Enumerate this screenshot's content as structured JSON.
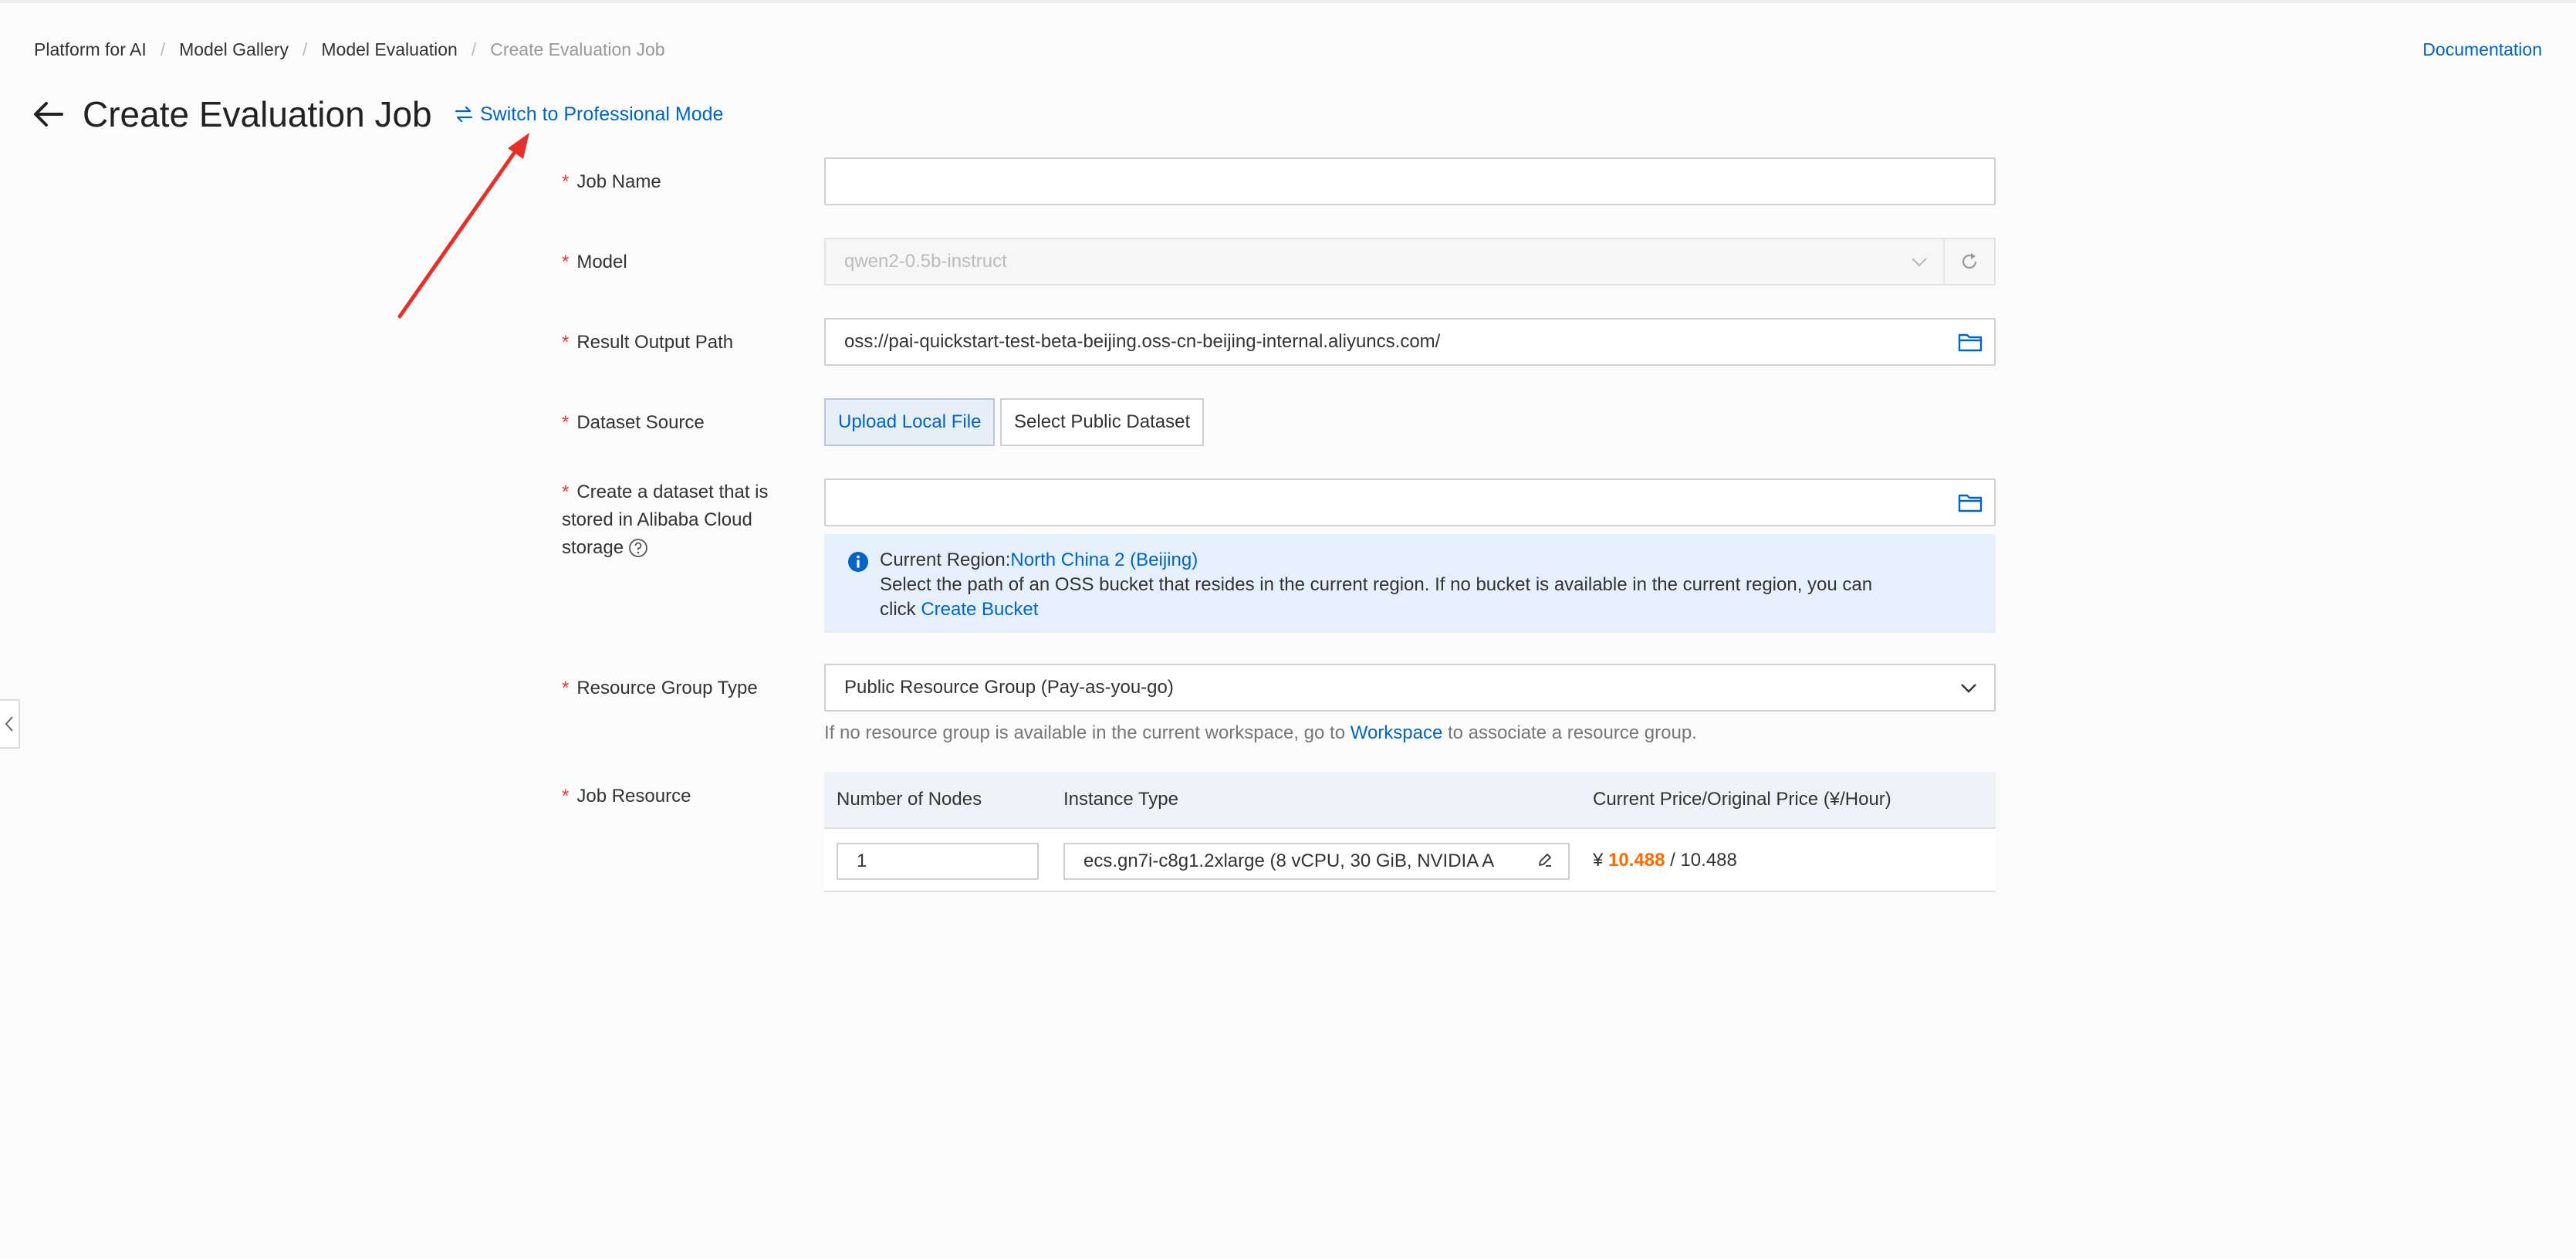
{
  "breadcrumb": {
    "items": [
      "Platform for AI",
      "Model Gallery",
      "Model Evaluation"
    ],
    "current": "Create Evaluation Job",
    "separator": "/"
  },
  "header": {
    "documentation_link": "Documentation",
    "title": "Create Evaluation Job",
    "switch_mode_label": "Switch to Professional Mode"
  },
  "form": {
    "required_marker": "*",
    "job_name": {
      "label": "Job Name",
      "value": ""
    },
    "model": {
      "label": "Model",
      "value": "qwen2-0.5b-instruct"
    },
    "result_output_path": {
      "label": "Result Output Path",
      "value": "oss://pai-quickstart-test-beta-beijing.oss-cn-beijing-internal.aliyuncs.com/"
    },
    "dataset_source": {
      "label": "Dataset Source",
      "options": [
        "Upload Local File",
        "Select Public Dataset"
      ],
      "selected": "Upload Local File"
    },
    "dataset_storage": {
      "label_line1": "Create a dataset that is",
      "label_line2": "stored in Alibaba Cloud",
      "label_line3": "storage",
      "value": "",
      "info": {
        "region_prefix": "Current Region:",
        "region": "North China 2 (Beijing)",
        "message": "Select the path of an OSS bucket that resides in the current region. If no bucket is available in the current region, you can",
        "click_text": "click",
        "create_bucket_link": "Create Bucket"
      }
    },
    "resource_group_type": {
      "label": "Resource Group Type",
      "value": "Public Resource Group (Pay-as-you-go)",
      "help_prefix": "If no resource group is available in the current workspace, go to",
      "help_link": "Workspace",
      "help_suffix": "to associate a resource group."
    },
    "job_resource": {
      "label": "Job Resource",
      "columns": [
        "Number of Nodes",
        "Instance Type",
        "Current Price/Original Price (¥/Hour)"
      ],
      "nodes": "1",
      "instance_type": "ecs.gn7i-c8g1.2xlarge  (8 vCPU, 30 GiB, NVIDIA A",
      "currency": "¥",
      "current_price": "10.488",
      "price_separator": "/",
      "original_price": "10.488"
    }
  },
  "colors": {
    "link": "#0064c8",
    "required": "#e5393b",
    "price_highlight": "#ff6a00",
    "annotation_arrow": "#e8302a"
  }
}
